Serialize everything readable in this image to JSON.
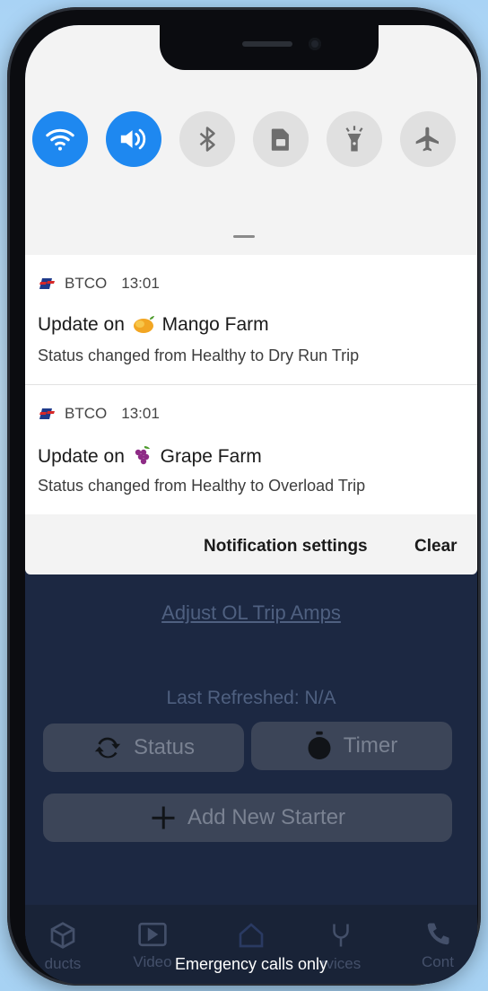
{
  "status_bar": {
    "emergency_text": "Emergency calls only"
  },
  "quick_settings": [
    {
      "icon": "wifi-icon",
      "state": "on"
    },
    {
      "icon": "volume-icon",
      "state": "on"
    },
    {
      "icon": "bluetooth-icon",
      "state": "off"
    },
    {
      "icon": "sim-card-icon",
      "state": "off"
    },
    {
      "icon": "flashlight-icon",
      "state": "off"
    },
    {
      "icon": "airplane-icon",
      "state": "off"
    }
  ],
  "notifications": [
    {
      "app": "BTCO",
      "time": "13:01",
      "title_prefix": "Update on",
      "emoji": "mango",
      "title_suffix": "Mango Farm",
      "body": "Status changed from Healthy to Dry Run Trip"
    },
    {
      "app": "BTCO",
      "time": "13:01",
      "title_prefix": "Update on",
      "emoji": "grapes",
      "title_suffix": "Grape Farm",
      "body": "Status changed from Healthy to Overload Trip"
    }
  ],
  "shade_actions": {
    "settings_label": "Notification settings",
    "clear_label": "Clear"
  },
  "app_background": {
    "link": "Adjust OL Trip Amps",
    "refreshed_label": "Last Refreshed:",
    "refreshed_value": "N/A",
    "status_button": "Status",
    "timer_button": "Timer",
    "add_button": "Add New Starter",
    "nav": [
      {
        "label": "ducts",
        "icon": "cube-icon"
      },
      {
        "label": "Video",
        "icon": "video-icon"
      },
      {
        "label": "",
        "icon": "home-icon"
      },
      {
        "label": "rvices",
        "icon": "wrench-icon"
      },
      {
        "label": "Cont",
        "icon": "phone-icon"
      }
    ]
  },
  "colors": {
    "accent": "#1e88f0",
    "shade": "#f3f3f3",
    "app_bg": "#1c2842"
  }
}
